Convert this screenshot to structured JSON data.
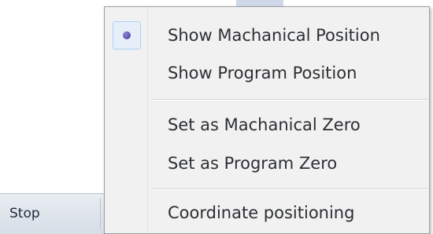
{
  "status_bar": {
    "stop_label": "Stop"
  },
  "context_menu": {
    "items": [
      {
        "label": "Show Machanical Position",
        "selected": true
      },
      {
        "label": "Show Program Position",
        "selected": false
      },
      {
        "label": "Set as Machanical Zero",
        "selected": false
      },
      {
        "label": "Set as Program Zero",
        "selected": false
      },
      {
        "label": "Coordinate positioning",
        "selected": false
      }
    ]
  }
}
